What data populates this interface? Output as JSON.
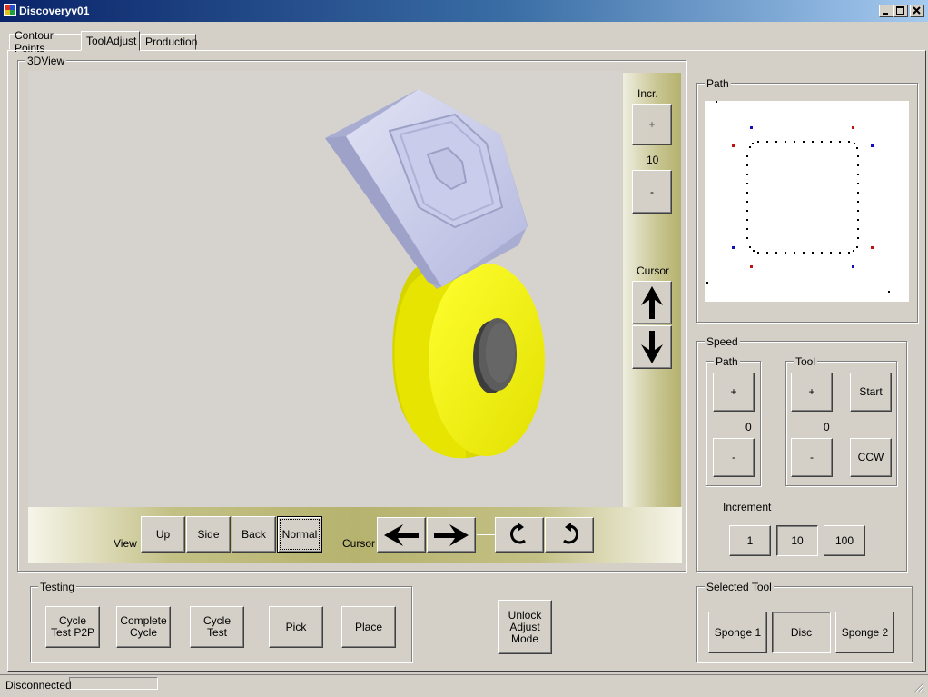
{
  "window": {
    "title": "Discoveryv01"
  },
  "tabs": [
    {
      "label": "Contour Points"
    },
    {
      "label": "ToolAdjust"
    },
    {
      "label": "Production"
    }
  ],
  "view3d": {
    "group_label": "3DView",
    "increment": {
      "title": "Incr.",
      "plus": "+",
      "value": "10",
      "minus": "-"
    },
    "cursor_vertical": {
      "title": "Cursor"
    },
    "view_bar": {
      "view_label": "View",
      "buttons": [
        "Up",
        "Side",
        "Back",
        "Normal"
      ],
      "cursor_label": "Cursor"
    }
  },
  "path_panel": {
    "group_label": "Path"
  },
  "speed": {
    "group_label": "Speed",
    "path": {
      "label": "Path",
      "plus": "+",
      "value": "0",
      "minus": "-"
    },
    "tool": {
      "label": "Tool",
      "plus": "+",
      "value": "0",
      "minus": "-",
      "start": "Start",
      "direction": "CCW"
    },
    "increment": {
      "label": "Increment",
      "options": [
        "1",
        "10",
        "100"
      ],
      "selected": "10"
    }
  },
  "testing": {
    "group_label": "Testing",
    "buttons": [
      "Cycle\nTest P2P",
      "Complete\nCycle",
      "Cycle\nTest",
      "Pick",
      "Place"
    ]
  },
  "unlock_button": "Unlock\nAdjust\nMode",
  "selected_tool": {
    "group_label": "Selected Tool",
    "options": [
      "Sponge 1",
      "Disc",
      "Sponge 2"
    ],
    "selected": "Disc"
  },
  "status": {
    "text": "Disconnected"
  },
  "colors": {
    "title_start": "#0a246a",
    "title_end": "#a6caf0",
    "disc": "#ffff00",
    "tool_body": "#c8cbe8",
    "panel_olive": "#b7b476"
  }
}
